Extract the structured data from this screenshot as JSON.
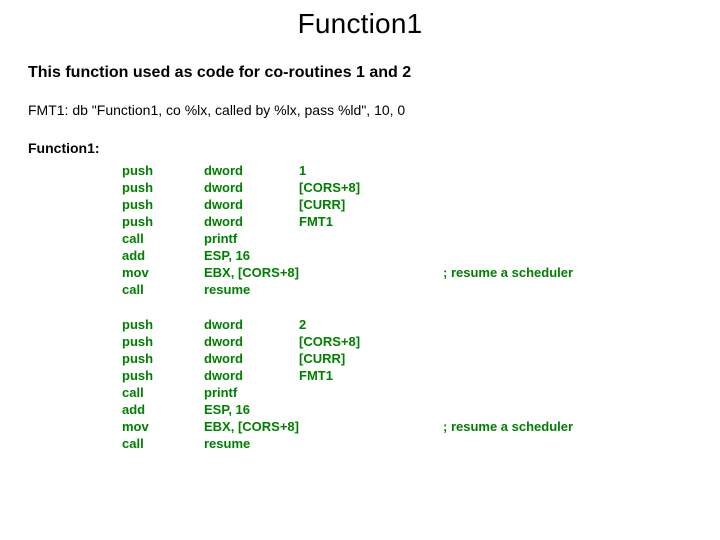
{
  "title": "Function1",
  "description": "This function used as code for co-routines 1 and 2",
  "fmt_line": "FMT1: db \"Function1, co %lx, called by %lx, pass %ld\", 10, 0",
  "label": "Function1:",
  "block1": {
    "rows": [
      {
        "op": "push",
        "arg1": "dword",
        "arg2": "1",
        "cmt": ""
      },
      {
        "op": "push",
        "arg1": "dword",
        "arg2": "[CORS+8]",
        "cmt": ""
      },
      {
        "op": "push",
        "arg1": "dword",
        "arg2": "[CURR]",
        "cmt": ""
      },
      {
        "op": "push",
        "arg1": "dword",
        "arg2": "FMT1",
        "cmt": ""
      },
      {
        "op": "call",
        "arg1": "printf",
        "arg2": "",
        "cmt": ""
      },
      {
        "op": "add",
        "arg1": "ESP, 16",
        "arg2": "",
        "cmt": ""
      },
      {
        "op": "mov",
        "arg1": "EBX, [CORS+8]",
        "arg2": "",
        "cmt": "; resume a scheduler"
      },
      {
        "op": "call",
        "arg1": "resume",
        "arg2": "",
        "cmt": ""
      }
    ]
  },
  "block2": {
    "rows": [
      {
        "op": "push",
        "arg1": "dword",
        "arg2": "2",
        "cmt": ""
      },
      {
        "op": "push",
        "arg1": "dword",
        "arg2": "[CORS+8]",
        "cmt": ""
      },
      {
        "op": "push",
        "arg1": "dword",
        "arg2": "[CURR]",
        "cmt": ""
      },
      {
        "op": "push",
        "arg1": "dword",
        "arg2": "FMT1",
        "cmt": ""
      },
      {
        "op": "call",
        "arg1": "printf",
        "arg2": "",
        "cmt": ""
      },
      {
        "op": "add",
        "arg1": "ESP, 16",
        "arg2": "",
        "cmt": ""
      },
      {
        "op": "mov",
        "arg1": "EBX, [CORS+8]",
        "arg2": "",
        "cmt": "; resume a scheduler"
      },
      {
        "op": "call",
        "arg1": "resume",
        "arg2": "",
        "cmt": ""
      }
    ]
  }
}
